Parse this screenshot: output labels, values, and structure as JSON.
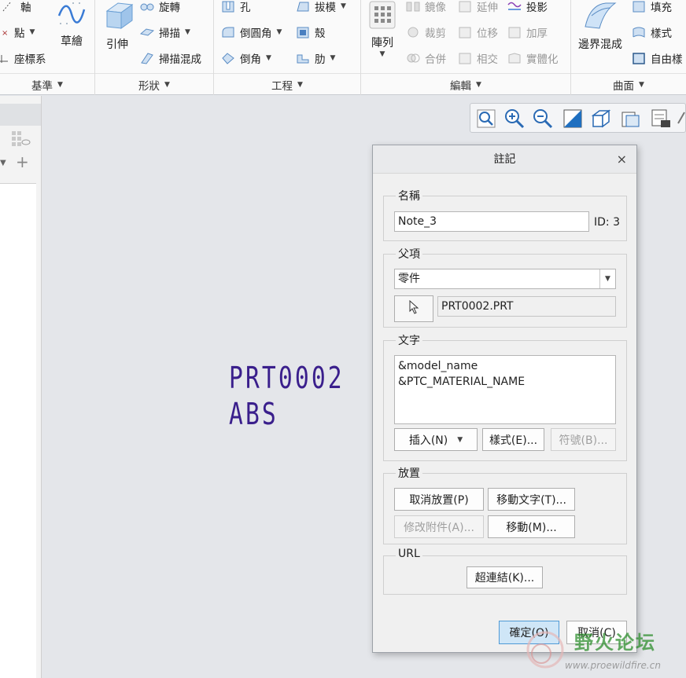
{
  "ribbon": {
    "datum": {
      "axis": "軸",
      "point": "點",
      "coord_sys": "座標系",
      "sketch": "草繪",
      "group": "基準"
    },
    "shapes": {
      "extrude": "引伸",
      "revolve": "旋轉",
      "sweep": "掃描",
      "swept_blend": "掃描混成",
      "group": "形狀"
    },
    "engineering": {
      "hole": "孔",
      "draft": "拔模",
      "round": "倒圓角",
      "shell": "殼",
      "chamfer": "倒角",
      "rib": "肋",
      "group": "工程"
    },
    "editing": {
      "pattern": "陣列",
      "mirror": "鏡像",
      "extend": "延伸",
      "project": "投影",
      "trim": "裁剪",
      "offset": "位移",
      "thicken": "加厚",
      "merge": "合併",
      "intersect": "相交",
      "solidify": "實體化",
      "group": "編輯"
    },
    "surfaces": {
      "boundary_blend": "邊界混成",
      "fill": "填充",
      "style": "樣式",
      "freestyle": "自由樣",
      "group": "曲面"
    }
  },
  "model_note": {
    "line1": "PRT0002",
    "line2": "ABS"
  },
  "dialog": {
    "title": "註記",
    "close": "×",
    "name_section": {
      "label": "名稱",
      "value": "Note_3",
      "id_text": "ID: 3"
    },
    "parent_section": {
      "label": "父項",
      "parent_type": "零件",
      "parent_ref": "PRT0002.PRT"
    },
    "text_section": {
      "label": "文字",
      "lines": [
        "&model_name",
        "&PTC_MATERIAL_NAME"
      ],
      "insert_button": "插入(N)",
      "style_button": "樣式(E)...",
      "symbol_button": "符號(B)..."
    },
    "placement_section": {
      "label": "放置",
      "unplace_button": "取消放置(P)",
      "move_text_button": "移動文字(T)...",
      "modify_attach_button": "修改附件(A)...",
      "move_button": "移動(M)..."
    },
    "url_section": {
      "label": "URL",
      "hyperlink_button": "超連結(K)..."
    },
    "ok_button": "確定(O)",
    "cancel_button": "取消(C)"
  },
  "watermark": {
    "text": "野火论坛",
    "url": "www.proewildfire.cn"
  },
  "colors": {
    "accent": "#4f9ad6",
    "model_text": "#3a1f8c",
    "watermark": "#2f8f2f"
  }
}
